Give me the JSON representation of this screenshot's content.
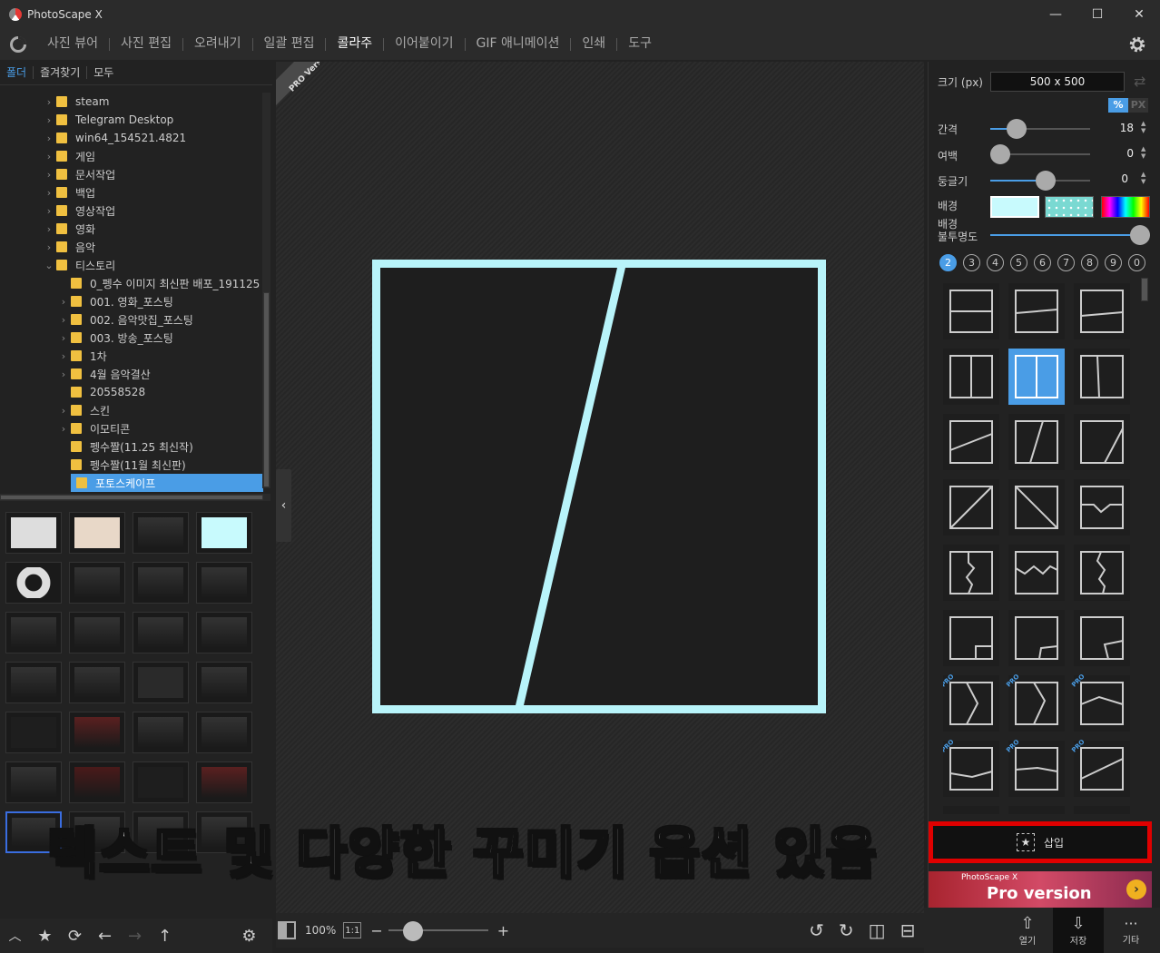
{
  "window": {
    "title": "PhotoScape X",
    "minimize": "—",
    "maximize": "☐",
    "close": "✕"
  },
  "menu": [
    {
      "label": "사진 뷰어"
    },
    {
      "label": "사진 편집"
    },
    {
      "label": "오려내기"
    },
    {
      "label": "일괄 편집"
    },
    {
      "label": "콜라주",
      "active": true
    },
    {
      "label": "이어붙이기"
    },
    {
      "label": "GIF 애니메이션"
    },
    {
      "label": "인쇄"
    },
    {
      "label": "도구"
    }
  ],
  "left": {
    "tabs": [
      "폴더",
      "즐겨찾기",
      "모두"
    ],
    "tree": [
      {
        "label": "steam"
      },
      {
        "label": "Telegram Desktop"
      },
      {
        "label": "win64_154521.4821"
      },
      {
        "label": "게임"
      },
      {
        "label": "문서작업"
      },
      {
        "label": "백업"
      },
      {
        "label": "영상작업"
      },
      {
        "label": "영화"
      },
      {
        "label": "음악"
      },
      {
        "label": "티스토리"
      },
      {
        "label": "0_펭수 이미지 최신판 배포_191125"
      },
      {
        "label": "001. 영화_포스팅"
      },
      {
        "label": "002. 음악맛집_포스팅"
      },
      {
        "label": "003. 방송_포스팅"
      },
      {
        "label": "1차"
      },
      {
        "label": "4월 음악결산"
      },
      {
        "label": "20558528"
      },
      {
        "label": "스킨"
      },
      {
        "label": "이모티콘"
      },
      {
        "label": "펭수짤(11.25 최신작)"
      },
      {
        "label": "펭수짤(11월 최신판)"
      },
      {
        "label": "포토스케이프"
      }
    ]
  },
  "canvas": {
    "pro_ribbon": "PRO Version",
    "zoom_label": "100%",
    "one_to_one": "1:1",
    "zoom_minus": "−",
    "zoom_plus": "+",
    "zoom_level": 0.18,
    "frame_color": "#b8f4fa"
  },
  "right": {
    "size_label": "크기 (px)",
    "size_value": "500 x 500",
    "unit_percent": "%",
    "unit_px": "PX",
    "spacing_label": "간격",
    "spacing_value": "18",
    "margin_label": "여백",
    "margin_value": "0",
    "round_label": "둥글기",
    "round_value": "0",
    "bg_label": "배경",
    "opacity_label_1": "배경",
    "opacity_label_2": "불투명도",
    "counts": [
      "2",
      "3",
      "4",
      "5",
      "6",
      "7",
      "8",
      "9",
      "0"
    ],
    "pro_tag": "PRO",
    "insert_label": "삽입",
    "banner_small": "PhotoScape X",
    "banner_big": "Pro version"
  },
  "bottom_right": {
    "open": "열기",
    "save": "저장",
    "more": "기타"
  },
  "caption": "텍스트 및 다양한 꾸미기 옵션 있음"
}
